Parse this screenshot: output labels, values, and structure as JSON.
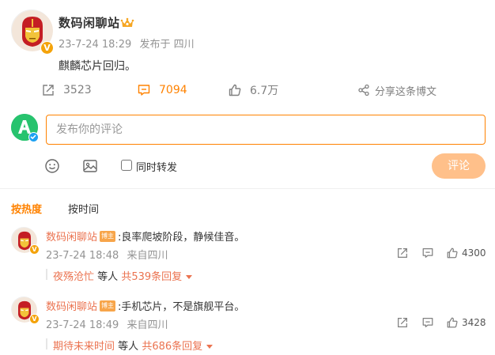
{
  "post": {
    "author": "数码闲聊站",
    "time": "23-7-24 18:29",
    "source": "发布于 四川",
    "text": "麒麟芯片回归。"
  },
  "actions": {
    "repost_count": "3523",
    "comment_count": "7094",
    "like_count": "6.7万",
    "share_label": "分享这条博文"
  },
  "composer": {
    "placeholder": "发布你的评论",
    "repost_label": "同时转发",
    "submit_label": "评论"
  },
  "sort_tabs": {
    "hot": "按热度",
    "time": "按时间"
  },
  "comments": [
    {
      "user": "数码闲聊站",
      "tag": "博主",
      "text": ":良率爬坡阶段，静候佳音。",
      "time": "23-7-24 18:48",
      "location": "来自四川",
      "likes": "4300",
      "reply_user": "夜殇沧忙",
      "reply_mid": "等人",
      "reply_count": "共539条回复"
    },
    {
      "user": "数码闲聊站",
      "tag": "博主",
      "text": ":手机芯片，不是旗舰平台。",
      "time": "23-7-24 18:49",
      "location": "来自四川",
      "likes": "3428",
      "reply_user": "期待未来时间",
      "reply_mid": "等人",
      "reply_count": "共686条回复"
    }
  ],
  "colors": {
    "accent": "#ff8200",
    "name": "#eb7350",
    "muted": "#939393",
    "submit_disabled": "#ffc08a"
  }
}
